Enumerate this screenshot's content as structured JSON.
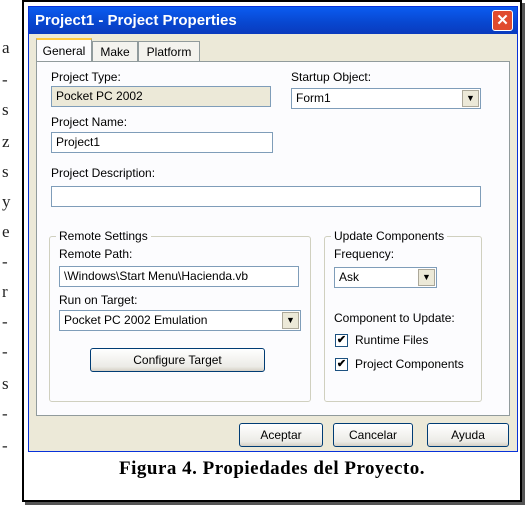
{
  "background_text": [
    "a",
    "-",
    "s",
    "z",
    "s",
    "y",
    "e",
    "-",
    "r",
    "-",
    "-",
    "s",
    "-",
    "-"
  ],
  "window": {
    "title": "Project1 - Project Properties",
    "close_glyph": "✕"
  },
  "tabs": [
    "General",
    "Make",
    "Platform"
  ],
  "general": {
    "project_type_label": "Project Type:",
    "project_type_value": "Pocket PC 2002",
    "startup_object_label": "Startup Object:",
    "startup_object_value": "Form1",
    "project_name_label": "Project Name:",
    "project_name_value": "Project1",
    "project_description_label": "Project Description:",
    "project_description_value": ""
  },
  "remote_settings": {
    "group_label": "Remote Settings",
    "remote_path_label": "Remote Path:",
    "remote_path_value": "\\Windows\\Start Menu\\Hacienda.vb",
    "run_on_target_label": "Run on Target:",
    "run_on_target_value": "Pocket PC 2002 Emulation",
    "configure_button": "Configure Target"
  },
  "update_components": {
    "group_label": "Update Components",
    "frequency_label": "Frequency:",
    "frequency_value": "Ask",
    "component_label": "Component to Update:",
    "checkboxes": [
      {
        "label": "Runtime Files",
        "checked": true
      },
      {
        "label": "Project Components",
        "checked": true
      }
    ]
  },
  "buttons": {
    "ok": "Aceptar",
    "cancel": "Cancelar",
    "help": "Ayuda"
  },
  "caption": "Figura 4. Propiedades del Proyecto.",
  "check_glyph": "✔",
  "dropdown_glyph": "▼",
  "colors": {
    "titlebar": "#0846cf",
    "dialog_bg": "#ece9d8",
    "close_button": "#e04b2e"
  }
}
